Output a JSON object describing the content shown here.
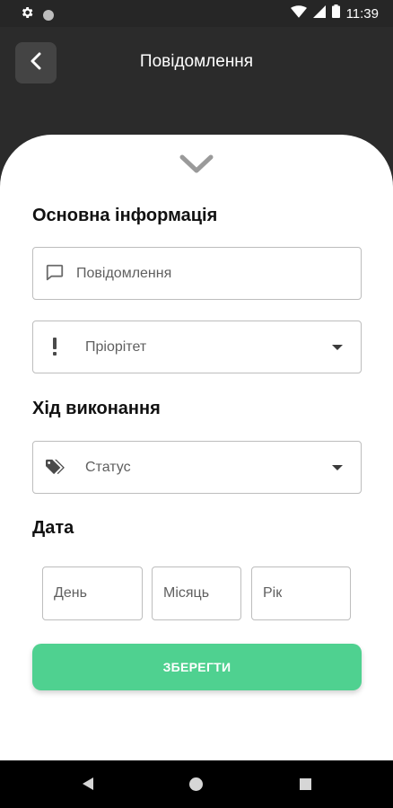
{
  "status_bar": {
    "time": "11:39",
    "icons": [
      "gear-icon",
      "notification-dot-icon",
      "wifi-icon",
      "signal-icon",
      "battery-icon"
    ]
  },
  "header": {
    "title": "Повідомлення",
    "back_icon": "chevron-left-icon"
  },
  "sheet": {
    "collapse_icon": "chevron-down-icon",
    "sections": {
      "basic_info": "Основна інформація",
      "progress": "Хід виконання",
      "date": "Дата"
    },
    "fields": {
      "message": {
        "placeholder": "Повідомлення",
        "icon": "message-icon"
      },
      "priority": {
        "placeholder": "Пріорітет",
        "icon": "exclamation-icon"
      },
      "status": {
        "placeholder": "Статус",
        "icon": "tag-icon"
      }
    },
    "date_fields": {
      "day": "День",
      "month": "Місяць",
      "year": "Рік"
    },
    "save_label": "ЗБЕРЕГТИ"
  },
  "colors": {
    "dark_bg": "#2b2b2b",
    "accent": "#4fd190",
    "border": "#bdbdbd"
  }
}
